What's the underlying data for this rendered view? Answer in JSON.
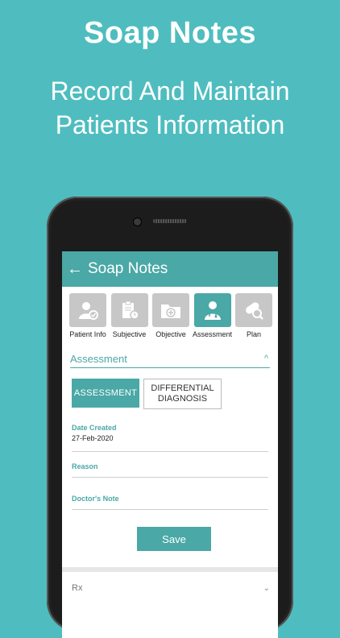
{
  "promo": {
    "title": "Soap Notes",
    "subtitle_line1": "Record And Maintain",
    "subtitle_line2": "Patients Information"
  },
  "appbar": {
    "back_icon": "←",
    "title": "Soap Notes"
  },
  "tabs": [
    {
      "label": "Patient Info",
      "icon": "patient-icon",
      "active": false
    },
    {
      "label": "Subjective",
      "icon": "clipboard-clock-icon",
      "active": false
    },
    {
      "label": "Objective",
      "icon": "folder-plus-icon",
      "active": false
    },
    {
      "label": "Assessment",
      "icon": "doctor-icon",
      "active": true
    },
    {
      "label": "Plan",
      "icon": "pill-search-icon",
      "active": false
    }
  ],
  "section": {
    "title": "Assessment",
    "chevron": "^"
  },
  "toggle": {
    "assessment_label": "ASSESSMENT",
    "differential_line1": "DIFFERENTIAL",
    "differential_line2": "DIAGNOSIS"
  },
  "fields": {
    "date_created": {
      "label": "Date Created",
      "value": "27-Feb-2020"
    },
    "reason": {
      "label": "Reason",
      "value": ""
    },
    "doctors_note": {
      "label": "Doctor's Note",
      "value": ""
    }
  },
  "save_label": "Save",
  "rx": {
    "label": "Rx"
  },
  "colors": {
    "background": "#4fbdbf",
    "accent": "#4aa8a6",
    "tab_inactive": "#c7c7c7"
  }
}
